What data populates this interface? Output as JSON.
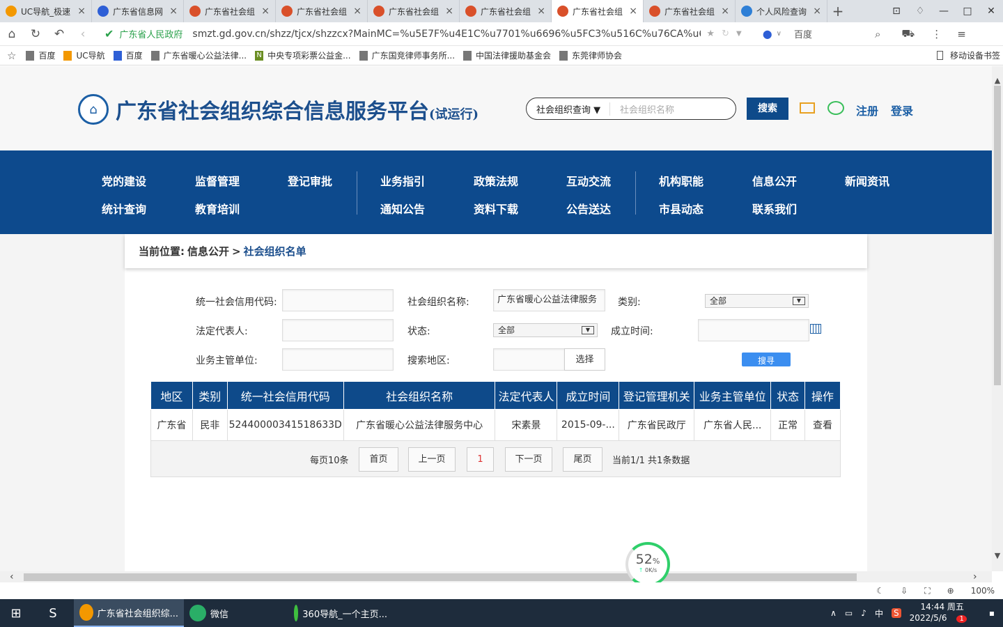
{
  "browser": {
    "tabs": [
      {
        "title": "UC导航_极速",
        "color": "#f39800",
        "active": false
      },
      {
        "title": "广东省信息网",
        "color": "#2e5fd6",
        "active": false
      },
      {
        "title": "广东省社会组",
        "color": "#d9502a",
        "active": false
      },
      {
        "title": "广东省社会组",
        "color": "#d9502a",
        "active": false
      },
      {
        "title": "广东省社会组",
        "color": "#d9502a",
        "active": false
      },
      {
        "title": "广东省社会组",
        "color": "#d9502a",
        "active": false
      },
      {
        "title": "广东省社会组",
        "color": "#d9502a",
        "active": true
      },
      {
        "title": "广东省社会组",
        "color": "#d9502a",
        "active": false
      },
      {
        "title": "个人风险查询",
        "color": "#2e7fd6",
        "active": false
      }
    ],
    "new_tab": "+",
    "site_name": "广东省人民政府",
    "url": "smzt.gd.gov.cn/shzz/tjcx/shzzcx?MainMC=%u5E7F%u4E1C%u7701%u6696%u5FC3%u516C%u76CA%u6CD5",
    "search_engine": "百度",
    "bookmarks": [
      "百度",
      "UC导航",
      "百度",
      "广东省暖心公益法律...",
      "中央专项彩票公益金...",
      "广东国竞律师事务所...",
      "中国法律援助基金会",
      "东莞律师协会"
    ],
    "mobile_bookmarks": "移动设备书签",
    "zoom": "100%"
  },
  "header": {
    "title": "广东省社会组织综合信息服务平台",
    "title_suffix": "(试运行)",
    "search_select": "社会组织查询",
    "search_placeholder": "社会组织名称",
    "search_button": "搜索",
    "register": "注册",
    "login": "登录"
  },
  "nav": {
    "row1": [
      "党的建设",
      "监督管理",
      "登记审批",
      "业务指引",
      "政策法规",
      "互动交流",
      "机构职能",
      "信息公开",
      "新闻资讯"
    ],
    "row2": [
      "统计查询",
      "教育培训",
      "通知公告",
      "资料下载",
      "公告送达",
      "市县动态",
      "联系我们"
    ]
  },
  "breadcrumb": {
    "prefix": "当前位置:",
    "parent": "信息公开",
    "sep": ">",
    "current": "社会组织名单"
  },
  "form": {
    "credit_code_label": "统一社会信用代码:",
    "credit_code_value": "",
    "org_name_label": "社会组织名称:",
    "org_name_value": "广东省暖心公益法律服务",
    "category_label": "类别:",
    "category_value": "全部",
    "legal_rep_label": "法定代表人:",
    "legal_rep_value": "",
    "status_label": "状态:",
    "status_value": "全部",
    "founded_label": "成立时间:",
    "founded_value": "",
    "supervisor_label": "业务主管单位:",
    "supervisor_value": "",
    "region_label": "搜索地区:",
    "region_value": "",
    "choose_button": "选择",
    "query_button": "搜寻"
  },
  "table": {
    "headers": [
      "地区",
      "类别",
      "统一社会信用代码",
      "社会组织名称",
      "法定代表人",
      "成立时间",
      "登记管理机关",
      "业务主管单位",
      "状态",
      "操作"
    ],
    "rows": [
      [
        "广东省",
        "民非",
        "52440000341518633D",
        "广东省暖心公益法律服务中心",
        "宋素景",
        "2015-09-...",
        "广东省民政厅",
        "广东省人民...",
        "正常",
        "查看"
      ]
    ]
  },
  "pager": {
    "per_page": "每页10条",
    "first": "首页",
    "prev": "上一页",
    "current": "1",
    "next": "下一页",
    "last": "尾页",
    "summary": "当前1/1 共1条数据"
  },
  "network": {
    "percent": "52",
    "unit": "%",
    "speed": "0K/s"
  },
  "taskbar": {
    "items": [
      {
        "label": "广东省社会组织综...",
        "color": "#f39800",
        "active": true
      },
      {
        "label": "微信",
        "color": "#2aae67",
        "active": false
      },
      {
        "label": "360导航_一个主页...",
        "color": "#3fbf3f",
        "active": false
      }
    ],
    "ime": "中",
    "time": "14:44 周五",
    "date": "2022/5/6",
    "badge": "1"
  }
}
